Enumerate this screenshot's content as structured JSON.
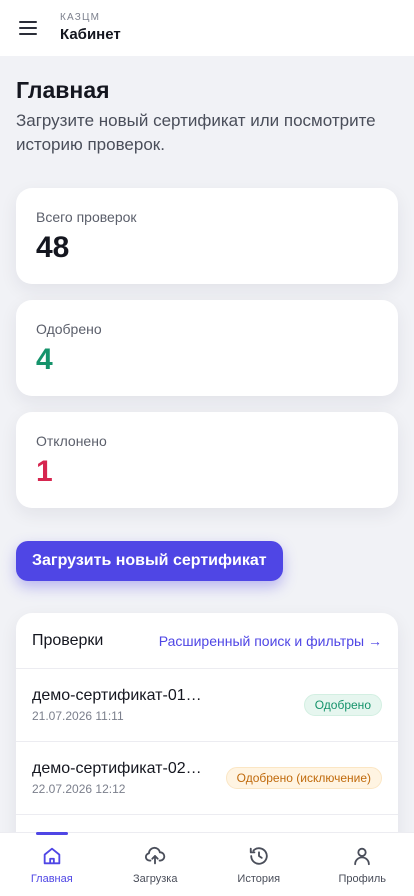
{
  "header": {
    "menu_icon": "hamburger-icon",
    "kicker": "КАЗЦМ",
    "title": "Кабинет"
  },
  "main": {
    "title": "Главная",
    "subtitle": "Загрузите новый сертификат или посмотрите историю проверок."
  },
  "stats": [
    {
      "label": "Всего проверок",
      "value": "48",
      "color": "#14161f"
    },
    {
      "label": "Одобрено",
      "value": "4",
      "color": "#15936b"
    },
    {
      "label": "Отклонено",
      "value": "1",
      "color": "#d6264f"
    }
  ],
  "upload_button": "Загрузить новый сертификат",
  "checks": {
    "title": "Проверки",
    "link": "Расширенный поиск и фильтры →",
    "rows": [
      {
        "name": "демо-сертификат-01.pdf",
        "date": "21.07.2026 11:11",
        "status": "Одобрено",
        "status_color": "#15936b"
      },
      {
        "name": "демо-сертификат-02.pdf",
        "date": "22.07.2026 12:12",
        "status": "Одобрено (исключение)",
        "status_color": "#c06a0c"
      }
    ]
  },
  "nav": {
    "active_color": "#4f46e5",
    "items": [
      {
        "label": "Главная",
        "icon": "home-icon",
        "active": true
      },
      {
        "label": "Загрузка",
        "icon": "cloud-upload-icon",
        "active": false
      },
      {
        "label": "История",
        "icon": "history-icon",
        "active": false
      },
      {
        "label": "Профиль",
        "icon": "user-icon",
        "active": false
      }
    ]
  }
}
